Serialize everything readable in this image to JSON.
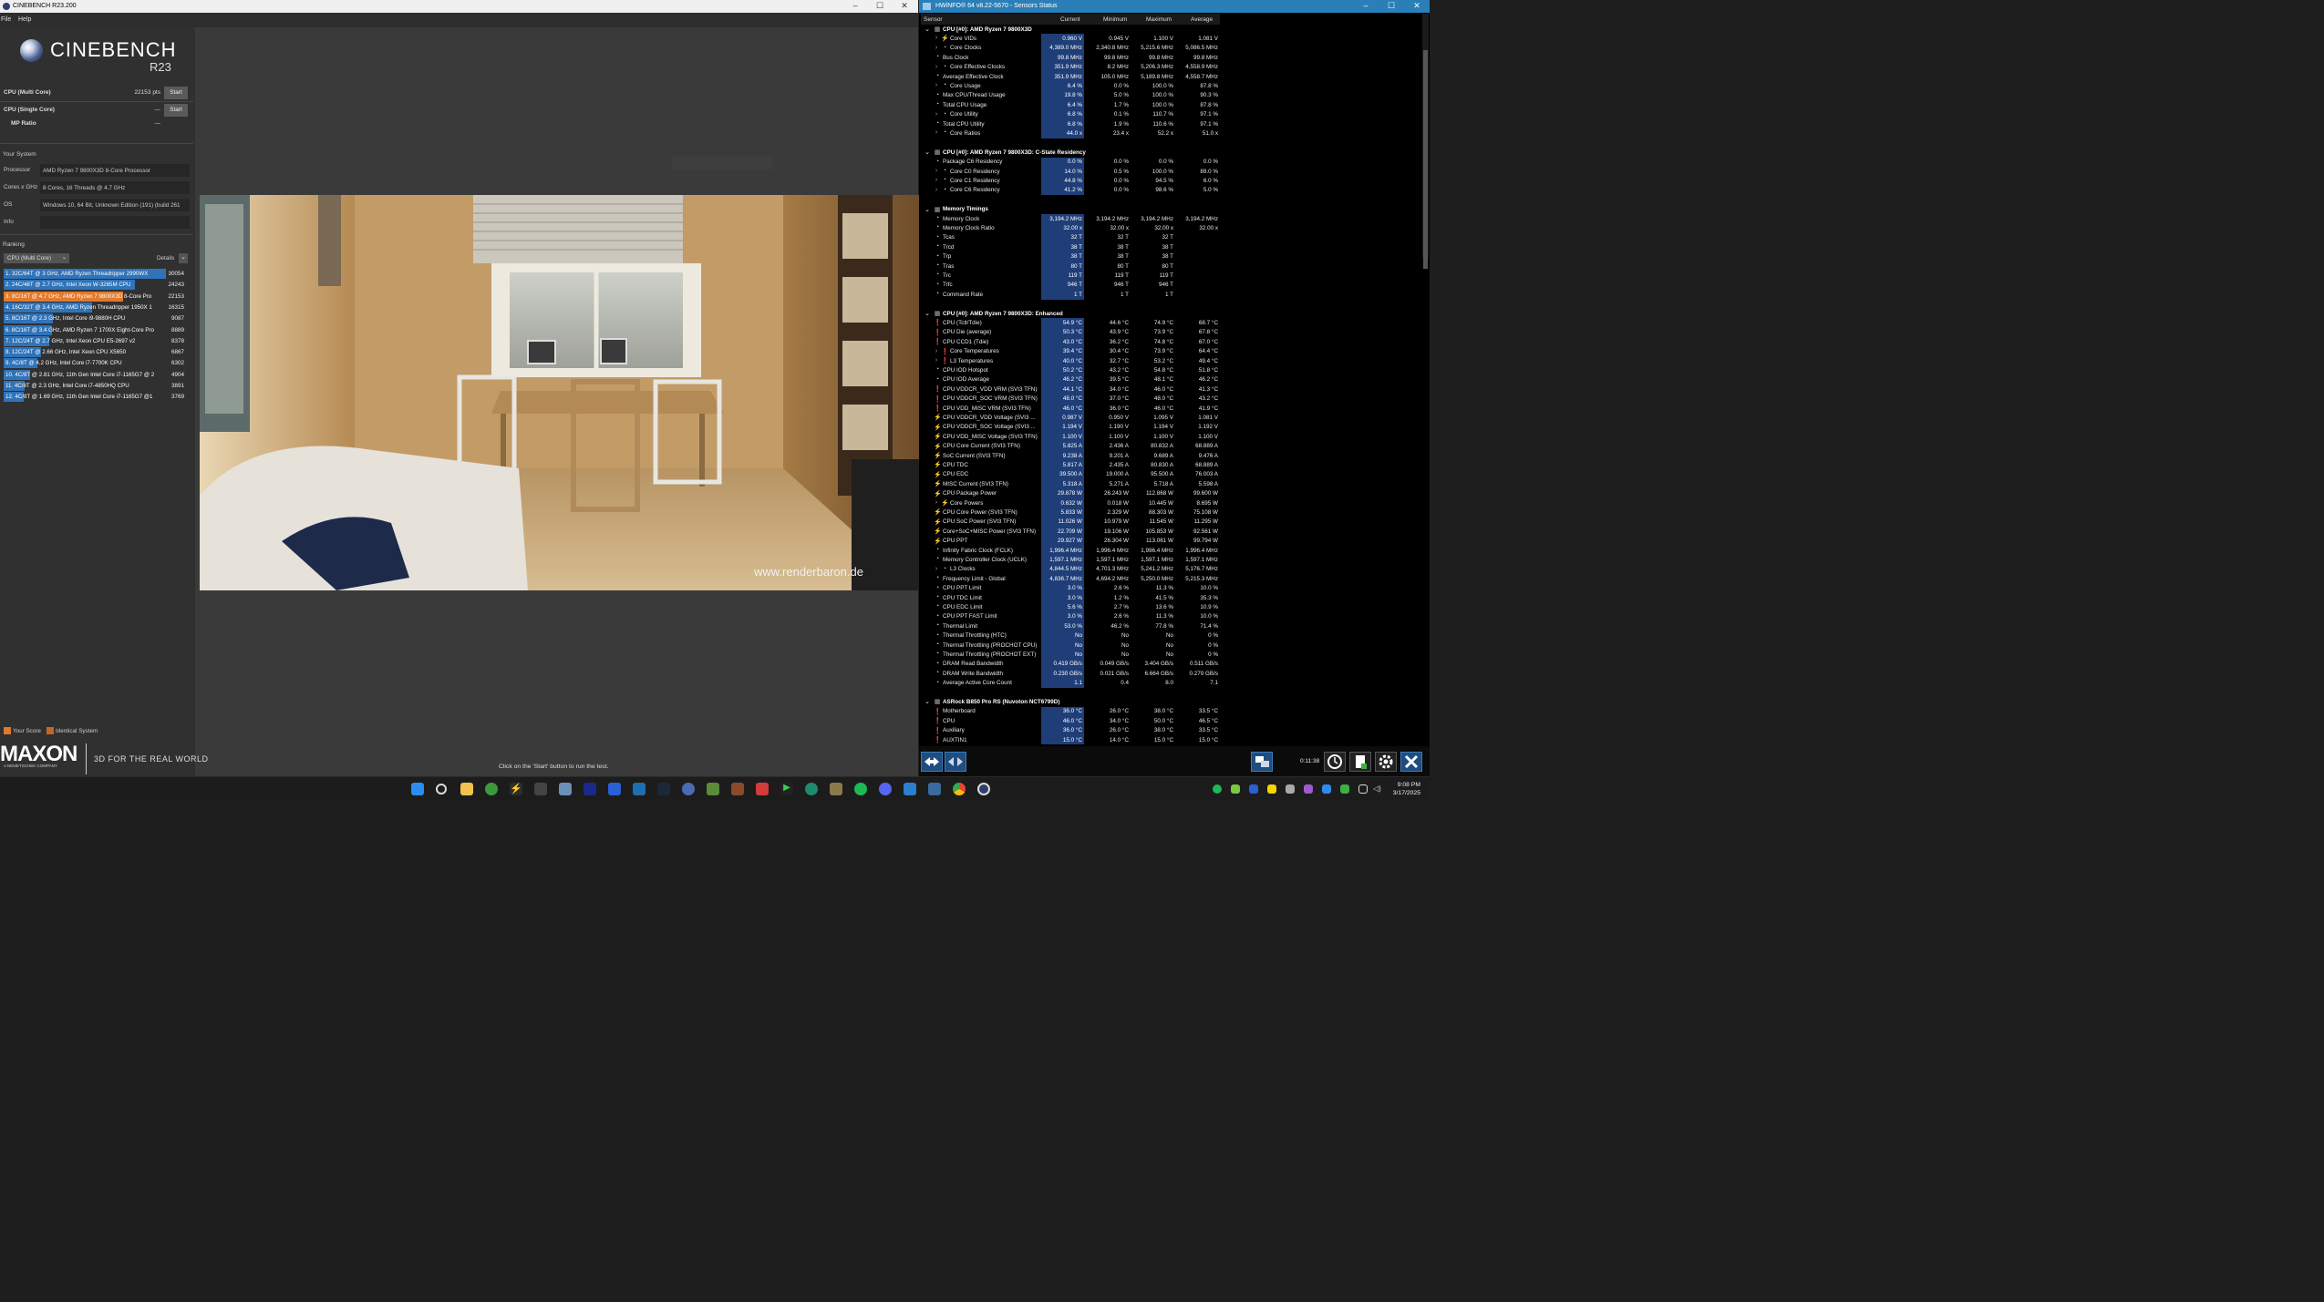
{
  "cinebench": {
    "window_title": "CINEBENCH R23.200",
    "menu": [
      "File",
      "Help"
    ],
    "logo": {
      "name": "CINEBENCH",
      "version": "R23"
    },
    "tests": [
      {
        "label": "CPU (Multi Core)",
        "value": "22153 pts",
        "button": "Start"
      },
      {
        "label": "CPU (Single Core)",
        "value": "---",
        "button": "Start"
      },
      {
        "label": "MP Ratio",
        "value": "---"
      }
    ],
    "your_system_label": "Your System",
    "system": [
      {
        "key": "Processor",
        "value": "AMD Ryzen 7 9800X3D 8-Core Processor"
      },
      {
        "key": "Cores x GHz",
        "value": "8 Cores, 16 Threads @ 4.7 GHz"
      },
      {
        "key": "OS",
        "value": "Windows 10, 64 Bit, Unknown Edition (191) (build 261"
      },
      {
        "key": "Info",
        "value": ""
      }
    ],
    "ranking_label": "Ranking",
    "ranking_dropdown": "CPU (Multi Core)",
    "details_label": "Details",
    "ranking": [
      {
        "name": "1. 32C/64T @ 3 GHz, AMD Ryzen Threadripper 2990WX",
        "score": 30054,
        "pct": 1.0,
        "kind": "other"
      },
      {
        "name": "2. 24C/48T @ 2.7 GHz, Intel Xeon W-3265M CPU",
        "score": 24243,
        "pct": 0.807,
        "kind": "other"
      },
      {
        "name": "3. 8C/16T @ 4.7 GHz, AMD Ryzen 7 9800X3D 8-Core Pro",
        "score": 22153,
        "pct": 0.737,
        "kind": "yours"
      },
      {
        "name": "4. 16C/32T @ 3.4 GHz, AMD Ryzen Threadripper 1950X 1",
        "score": 16315,
        "pct": 0.543,
        "kind": "other"
      },
      {
        "name": "5. 8C/16T @ 2.3 GHz, Intel Core i9-9880H CPU",
        "score": 9087,
        "pct": 0.302,
        "kind": "other"
      },
      {
        "name": "6. 8C/16T @ 3.4 GHz, AMD Ryzen 7 1700X Eight-Core Pro",
        "score": 8889,
        "pct": 0.296,
        "kind": "other"
      },
      {
        "name": "7. 12C/24T @ 2.7 GHz, Intel Xeon CPU E5-2697 v2",
        "score": 8378,
        "pct": 0.279,
        "kind": "other"
      },
      {
        "name": "8. 12C/24T @ 2.66 GHz, Intel Xeon CPU X5650",
        "score": 6867,
        "pct": 0.228,
        "kind": "other"
      },
      {
        "name": "9. 4C/8T @ 4.2 GHz, Intel Core i7-7700K CPU",
        "score": 6302,
        "pct": 0.21,
        "kind": "other"
      },
      {
        "name": "10. 4C/8T @ 2.81 GHz, 11th Gen Intel Core i7-1165G7 @ 2",
        "score": 4904,
        "pct": 0.163,
        "kind": "other"
      },
      {
        "name": "11. 4C/8T @ 2.3 GHz, Intel Core i7-4850HQ CPU",
        "score": 3891,
        "pct": 0.129,
        "kind": "other"
      },
      {
        "name": "12. 4C/8T @ 1.69 GHz, 11th Gen Intel Core i7-1165G7 @1",
        "score": 3769,
        "pct": 0.125,
        "kind": "other"
      }
    ],
    "legend": {
      "your_score": "Your Score",
      "identical": "Identical System"
    },
    "brand": {
      "maxon": "MAXON",
      "maxon_sub": "A NEMETSCHEK COMPANY",
      "tagline": "3D FOR THE REAL WORLD"
    },
    "hint": "Click on the 'Start' button to run the test.",
    "watermark": "www.renderbaron.de",
    "colors": {
      "your": "#e07a2c",
      "other": "#2f73b8",
      "identical": "#c8642a"
    }
  },
  "hwinfo": {
    "window_title": "HWiNFO® 64 v8.22-5670 - Sensors Status",
    "columns": [
      "Sensor",
      "Current",
      "Minimum",
      "Maximum",
      "Average"
    ],
    "rows": [
      {
        "t": "g",
        "n": "CPU [#0]: AMD Ryzen 7 9800X3D"
      },
      {
        "t": "s",
        "i": "v",
        "x": 1,
        "n": "Core VIDs",
        "c": "0.960 V",
        "mn": "0.945 V",
        "mx": "1.100 V",
        "av": "1.081 V"
      },
      {
        "t": "s",
        "i": "c",
        "x": 1,
        "n": "Core Clocks",
        "c": "4,389.0 MHz",
        "mn": "2,340.8 MHz",
        "mx": "5,215.6 MHz",
        "av": "5,086.5 MHz"
      },
      {
        "t": "s",
        "i": "c",
        "n": "Bus Clock",
        "c": "99.8 MHz",
        "mn": "99.8 MHz",
        "mx": "99.8 MHz",
        "av": "99.8 MHz"
      },
      {
        "t": "s",
        "i": "c",
        "x": 1,
        "n": "Core Effective Clocks",
        "c": "351.9 MHz",
        "mn": "8.2 MHz",
        "mx": "5,206.3 MHz",
        "av": "4,558.9 MHz"
      },
      {
        "t": "s",
        "i": "c",
        "n": "Average Effective Clock",
        "c": "351.9 MHz",
        "mn": "105.0 MHz",
        "mx": "5,189.8 MHz",
        "av": "4,558.7 MHz"
      },
      {
        "t": "s",
        "i": "c",
        "x": 1,
        "n": "Core Usage",
        "c": "6.4 %",
        "mn": "0.0 %",
        "mx": "100.0 %",
        "av": "87.8 %"
      },
      {
        "t": "s",
        "i": "c",
        "n": "Max CPU/Thread Usage",
        "c": "19.8 %",
        "mn": "5.0 %",
        "mx": "100.0 %",
        "av": "90.3 %"
      },
      {
        "t": "s",
        "i": "c",
        "n": "Total CPU Usage",
        "c": "6.4 %",
        "mn": "1.7 %",
        "mx": "100.0 %",
        "av": "87.8 %"
      },
      {
        "t": "s",
        "i": "c",
        "x": 1,
        "n": "Core Utility",
        "c": "6.8 %",
        "mn": "0.1 %",
        "mx": "110.7 %",
        "av": "97.1 %"
      },
      {
        "t": "s",
        "i": "c",
        "n": "Total CPU Utility",
        "c": "6.8 %",
        "mn": "1.9 %",
        "mx": "110.6 %",
        "av": "97.1 %"
      },
      {
        "t": "s",
        "i": "c",
        "x": 1,
        "n": "Core Ratios",
        "c": "44.0 x",
        "mn": "23.4 x",
        "mx": "52.2 x",
        "av": "51.0 x"
      },
      {
        "t": "b"
      },
      {
        "t": "g",
        "n": "CPU [#0]: AMD Ryzen 7 9800X3D: C-State Residency"
      },
      {
        "t": "s",
        "i": "c",
        "n": "Package C6 Residency",
        "c": "0.0 %",
        "mn": "0.0 %",
        "mx": "0.0 %",
        "av": "0.0 %"
      },
      {
        "t": "s",
        "i": "c",
        "x": 1,
        "n": "Core C0 Residency",
        "c": "14.0 %",
        "mn": "0.5 %",
        "mx": "100.0 %",
        "av": "89.0 %"
      },
      {
        "t": "s",
        "i": "c",
        "x": 1,
        "n": "Core C1 Residency",
        "c": "44.8 %",
        "mn": "0.0 %",
        "mx": "94.5 %",
        "av": "6.0 %"
      },
      {
        "t": "s",
        "i": "c",
        "x": 1,
        "n": "Core C6 Residency",
        "c": "41.2 %",
        "mn": "0.0 %",
        "mx": "98.6 %",
        "av": "5.0 %"
      },
      {
        "t": "b"
      },
      {
        "t": "g",
        "n": "Memory Timings"
      },
      {
        "t": "s",
        "i": "c",
        "n": "Memory Clock",
        "c": "3,194.2 MHz",
        "mn": "3,194.2 MHz",
        "mx": "3,194.2 MHz",
        "av": "3,194.2 MHz"
      },
      {
        "t": "s",
        "i": "c",
        "n": "Memory Clock Ratio",
        "c": "32.00 x",
        "mn": "32.00 x",
        "mx": "32.00 x",
        "av": "32.00 x"
      },
      {
        "t": "s",
        "i": "c",
        "n": "Tcas",
        "c": "32 T",
        "mn": "32 T",
        "mx": "32 T",
        "av": ""
      },
      {
        "t": "s",
        "i": "c",
        "n": "Trcd",
        "c": "38 T",
        "mn": "38 T",
        "mx": "38 T",
        "av": ""
      },
      {
        "t": "s",
        "i": "c",
        "n": "Trp",
        "c": "38 T",
        "mn": "38 T",
        "mx": "38 T",
        "av": ""
      },
      {
        "t": "s",
        "i": "c",
        "n": "Tras",
        "c": "80 T",
        "mn": "80 T",
        "mx": "80 T",
        "av": ""
      },
      {
        "t": "s",
        "i": "c",
        "n": "Trc",
        "c": "119 T",
        "mn": "119 T",
        "mx": "119 T",
        "av": ""
      },
      {
        "t": "s",
        "i": "c",
        "n": "Trfc",
        "c": "946 T",
        "mn": "946 T",
        "mx": "946 T",
        "av": ""
      },
      {
        "t": "s",
        "i": "c",
        "n": "Command Rate",
        "c": "1 T",
        "mn": "1 T",
        "mx": "1 T",
        "av": ""
      },
      {
        "t": "b"
      },
      {
        "t": "g",
        "n": "CPU [#0]: AMD Ryzen 7 9800X3D: Enhanced"
      },
      {
        "t": "s",
        "i": "t",
        "n": "CPU (Tctl/Tdie)",
        "c": "54.9 °C",
        "mn": "44.6 °C",
        "mx": "74.9 °C",
        "av": "68.7 °C"
      },
      {
        "t": "s",
        "i": "t",
        "n": "CPU Die (average)",
        "c": "50.3 °C",
        "mn": "43.9 °C",
        "mx": "73.9 °C",
        "av": "67.8 °C"
      },
      {
        "t": "s",
        "i": "t",
        "n": "CPU CCD1 (Tdie)",
        "c": "43.0 °C",
        "mn": "36.2 °C",
        "mx": "74.8 °C",
        "av": "67.0 °C"
      },
      {
        "t": "s",
        "i": "t",
        "x": 1,
        "n": "Core Temperatures",
        "c": "39.4 °C",
        "mn": "30.4 °C",
        "mx": "73.9 °C",
        "av": "64.4 °C"
      },
      {
        "t": "s",
        "i": "t",
        "x": 1,
        "n": "L3 Temperatures",
        "c": "40.0 °C",
        "mn": "32.7 °C",
        "mx": "53.2 °C",
        "av": "49.4 °C"
      },
      {
        "t": "s",
        "i": "c",
        "n": "CPU IOD Hotspot",
        "c": "50.2 °C",
        "mn": "43.2 °C",
        "mx": "54.8 °C",
        "av": "51.8 °C"
      },
      {
        "t": "s",
        "i": "c",
        "n": "CPU IOD Average",
        "c": "46.2 °C",
        "mn": "39.5 °C",
        "mx": "48.1 °C",
        "av": "46.2 °C"
      },
      {
        "t": "s",
        "i": "t",
        "n": "CPU VDDCR_VDD VRM (SVI3 TFN)",
        "c": "44.1 °C",
        "mn": "34.0 °C",
        "mx": "46.0 °C",
        "av": "41.3 °C"
      },
      {
        "t": "s",
        "i": "t",
        "n": "CPU VDDCR_SOC VRM (SVI3 TFN)",
        "c": "48.0 °C",
        "mn": "37.0 °C",
        "mx": "48.0 °C",
        "av": "43.2 °C"
      },
      {
        "t": "s",
        "i": "t",
        "n": "CPU VDD_MISC VRM (SVI3 TFN)",
        "c": "46.0 °C",
        "mn": "36.0 °C",
        "mx": "46.0 °C",
        "av": "41.9 °C"
      },
      {
        "t": "s",
        "i": "v",
        "n": "CPU VDDCR_VDD Voltage (SVI3 ...",
        "c": "0.987 V",
        "mn": "0.950 V",
        "mx": "1.095 V",
        "av": "1.081 V"
      },
      {
        "t": "s",
        "i": "v",
        "n": "CPU VDDCR_SOC Voltage (SVI3 ...",
        "c": "1.194 V",
        "mn": "1.190 V",
        "mx": "1.194 V",
        "av": "1.192 V"
      },
      {
        "t": "s",
        "i": "v",
        "n": "CPU VDD_MISC Voltage (SVI3 TFN)",
        "c": "1.100 V",
        "mn": "1.100 V",
        "mx": "1.100 V",
        "av": "1.100 V"
      },
      {
        "t": "s",
        "i": "v",
        "n": "CPU Core Current (SVI3 TFN)",
        "c": "5.825 A",
        "mn": "2.436 A",
        "mx": "80.832 A",
        "av": "68.889 A"
      },
      {
        "t": "s",
        "i": "v",
        "n": "SoC Current (SVI3 TFN)",
        "c": "9.238 A",
        "mn": "9.201 A",
        "mx": "9.689 A",
        "av": "9.476 A"
      },
      {
        "t": "s",
        "i": "v",
        "n": "CPU TDC",
        "c": "5.817 A",
        "mn": "2.435 A",
        "mx": "80.830 A",
        "av": "68.889 A"
      },
      {
        "t": "s",
        "i": "v",
        "n": "CPU EDC",
        "c": "39.500 A",
        "mn": "19.000 A",
        "mx": "95.500 A",
        "av": "76.003 A"
      },
      {
        "t": "s",
        "i": "v",
        "n": "MISC Current (SVI3 TFN)",
        "c": "5.318 A",
        "mn": "5.271 A",
        "mx": "5.718 A",
        "av": "5.598 A"
      },
      {
        "t": "s",
        "i": "v",
        "n": "CPU Package Power",
        "c": "29.878 W",
        "mn": "26.243 W",
        "mx": "112.868 W",
        "av": "99.600 W"
      },
      {
        "t": "s",
        "i": "v",
        "x": 1,
        "n": "Core Powers",
        "c": "0.632 W",
        "mn": "0.018 W",
        "mx": "10.445 W",
        "av": "8.695 W"
      },
      {
        "t": "s",
        "i": "v",
        "n": "CPU Core Power (SVI3 TFN)",
        "c": "5.833 W",
        "mn": "2.329 W",
        "mx": "88.303 W",
        "av": "75.108 W"
      },
      {
        "t": "s",
        "i": "v",
        "n": "CPU SoC Power (SVI3 TFN)",
        "c": "11.026 W",
        "mn": "10.979 W",
        "mx": "11.545 W",
        "av": "11.295 W"
      },
      {
        "t": "s",
        "i": "v",
        "n": "Core+SoC+MISC Power (SVI3 TFN)",
        "c": "22.709 W",
        "mn": "19.106 W",
        "mx": "105.853 W",
        "av": "92.561 W"
      },
      {
        "t": "s",
        "i": "v",
        "n": "CPU PPT",
        "c": "29.927 W",
        "mn": "26.304 W",
        "mx": "113.061 W",
        "av": "99.794 W"
      },
      {
        "t": "s",
        "i": "c",
        "n": "Infinity Fabric Clock (FCLK)",
        "c": "1,996.4 MHz",
        "mn": "1,996.4 MHz",
        "mx": "1,996.4 MHz",
        "av": "1,996.4 MHz"
      },
      {
        "t": "s",
        "i": "c",
        "n": "Memory Controller Clock (UCLK)",
        "c": "1,597.1 MHz",
        "mn": "1,597.1 MHz",
        "mx": "1,597.1 MHz",
        "av": "1,597.1 MHz"
      },
      {
        "t": "s",
        "i": "c",
        "x": 1,
        "n": "L3 Clocks",
        "c": "4,844.5 MHz",
        "mn": "4,701.3 MHz",
        "mx": "5,241.2 MHz",
        "av": "5,176.7 MHz"
      },
      {
        "t": "s",
        "i": "c",
        "n": "Frequency Limit - Global",
        "c": "4,836.7 MHz",
        "mn": "4,694.2 MHz",
        "mx": "5,250.0 MHz",
        "av": "5,215.3 MHz"
      },
      {
        "t": "s",
        "i": "c",
        "n": "CPU PPT Limit",
        "c": "3.0 %",
        "mn": "2.6 %",
        "mx": "11.3 %",
        "av": "10.0 %"
      },
      {
        "t": "s",
        "i": "c",
        "n": "CPU TDC Limit",
        "c": "3.0 %",
        "mn": "1.2 %",
        "mx": "41.5 %",
        "av": "35.3 %"
      },
      {
        "t": "s",
        "i": "c",
        "n": "CPU EDC Limit",
        "c": "5.6 %",
        "mn": "2.7 %",
        "mx": "13.6 %",
        "av": "10.9 %"
      },
      {
        "t": "s",
        "i": "c",
        "n": "CPU PPT FAST Limit",
        "c": "3.0 %",
        "mn": "2.6 %",
        "mx": "11.3 %",
        "av": "10.0 %"
      },
      {
        "t": "s",
        "i": "c",
        "n": "Thermal Limit",
        "c": "53.0 %",
        "mn": "46.2 %",
        "mx": "77.8 %",
        "av": "71.4 %"
      },
      {
        "t": "s",
        "i": "c",
        "n": "Thermal Throttling (HTC)",
        "c": "No",
        "mn": "No",
        "mx": "No",
        "av": "0 %"
      },
      {
        "t": "s",
        "i": "c",
        "n": "Thermal Throttling (PROCHOT CPU)",
        "c": "No",
        "mn": "No",
        "mx": "No",
        "av": "0 %"
      },
      {
        "t": "s",
        "i": "c",
        "n": "Thermal Throttling (PROCHOT EXT)",
        "c": "No",
        "mn": "No",
        "mx": "No",
        "av": "0 %"
      },
      {
        "t": "s",
        "i": "c",
        "n": "DRAM Read Bandwidth",
        "c": "0.419 GB/s",
        "mn": "0.049 GB/s",
        "mx": "3.404 GB/s",
        "av": "0.511 GB/s"
      },
      {
        "t": "s",
        "i": "c",
        "n": "DRAM Write Bandwidth",
        "c": "0.230 GB/s",
        "mn": "0.021 GB/s",
        "mx": "6.664 GB/s",
        "av": "0.270 GB/s"
      },
      {
        "t": "s",
        "i": "c",
        "n": "Average Active Core Count",
        "c": "1.1",
        "mn": "0.4",
        "mx": "8.0",
        "av": "7.1"
      },
      {
        "t": "b"
      },
      {
        "t": "g",
        "n": "ASRock B850 Pro RS (Nuvoton NCT6799D)"
      },
      {
        "t": "s",
        "i": "t",
        "n": "Motherboard",
        "c": "36.0 °C",
        "mn": "26.0 °C",
        "mx": "38.0 °C",
        "av": "33.5 °C"
      },
      {
        "t": "s",
        "i": "t",
        "n": "CPU",
        "c": "46.0 °C",
        "mn": "34.0 °C",
        "mx": "50.0 °C",
        "av": "46.5 °C"
      },
      {
        "t": "s",
        "i": "t",
        "n": "Auxiliary",
        "c": "36.0 °C",
        "mn": "26.0 °C",
        "mx": "38.0 °C",
        "av": "33.5 °C"
      },
      {
        "t": "s",
        "i": "t",
        "n": "AUXTIN1",
        "c": "15.0 °C",
        "mn": "14.0 °C",
        "mx": "15.0 °C",
        "av": "15.0 °C"
      }
    ],
    "footer_time": "0:11:38"
  },
  "taskbar": {
    "time": "9:08 PM",
    "date": "3/17/2025"
  }
}
